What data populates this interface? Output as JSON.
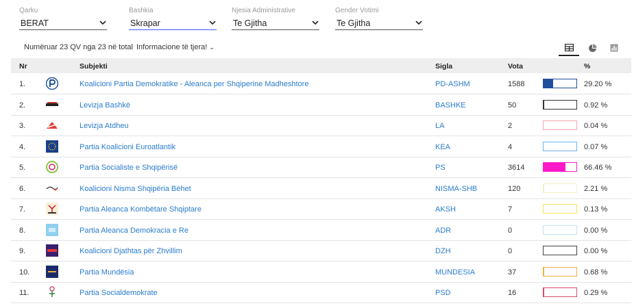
{
  "filters": [
    {
      "label": "Qarku",
      "value": "BERAT",
      "active": false
    },
    {
      "label": "Bashkia",
      "value": "Skrapar",
      "active": true
    },
    {
      "label": "Njesia Administrative",
      "value": "Te Gjitha",
      "active": false
    },
    {
      "label": "Gender Votimi",
      "value": "Te Gjitha",
      "active": false
    }
  ],
  "count_text": "Numëruar 23 QV nga 23 në total",
  "info_text": "Informacione të tjera!",
  "view_icons": [
    "table-icon",
    "pie-chart-icon",
    "bar-chart-icon"
  ],
  "table": {
    "headers": {
      "nr": "Nr",
      "subject": "Subjekti",
      "sigla": "Sigla",
      "votes": "Vota",
      "pct": "%"
    },
    "rows": [
      {
        "nr": "1.",
        "subject": "Koalicioni Partia Demokratike - Aleanca per Shqiperine Madheshtore",
        "sigla": "PD-ASHM",
        "votes": "1588",
        "pct": "29.20 %",
        "share": 0.292,
        "color": "#1f4e9c",
        "logo": "pd-logo-icon"
      },
      {
        "nr": "2.",
        "subject": "Levizja Bashkë",
        "sigla": "BASHKE",
        "votes": "50",
        "pct": "0.92 %",
        "share": 0.0092,
        "color": "#333333",
        "logo": "bashke-logo-icon"
      },
      {
        "nr": "3.",
        "subject": "Levizja Atdheu",
        "sigla": "LA",
        "votes": "2",
        "pct": "0.04 %",
        "share": 0.0004,
        "color": "#f4a7b4",
        "logo": "la-logo-icon"
      },
      {
        "nr": "4.",
        "subject": "Partia Koalicioni Euroatlantik",
        "sigla": "KEA",
        "votes": "4",
        "pct": "0.07 %",
        "share": 0.0007,
        "color": "#6fb1e8",
        "logo": "kea-logo-icon"
      },
      {
        "nr": "5.",
        "subject": "Partia Socialiste e Shqipërisë",
        "sigla": "PS",
        "votes": "3614",
        "pct": "66.46 %",
        "share": 0.6646,
        "color": "#ff19c8",
        "logo": "ps-logo-icon"
      },
      {
        "nr": "6.",
        "subject": "Koalicioni Nisma Shqipëria Bëhet",
        "sigla": "NISMA-SHB",
        "votes": "120",
        "pct": "2.21 %",
        "share": 0.0221,
        "color": "#f3f0c8",
        "logo": "nisma-logo-icon"
      },
      {
        "nr": "7.",
        "subject": "Partia Aleanca Kombëtare Shqiptare",
        "sigla": "AKSH",
        "votes": "7",
        "pct": "0.13 %",
        "share": 0.0013,
        "color": "#f7e25a",
        "logo": "aksh-logo-icon"
      },
      {
        "nr": "8.",
        "subject": "Partia Aleanca Demokracia e Re",
        "sigla": "ADR",
        "votes": "0",
        "pct": "0.00 %",
        "share": 0.0,
        "color": "#bfe3f5",
        "logo": "adr-logo-icon"
      },
      {
        "nr": "9.",
        "subject": "Koalicioni Djathtas për Zhvillim",
        "sigla": "DZH",
        "votes": "0",
        "pct": "0.00 %",
        "share": 0.0,
        "color": "#444444",
        "logo": "dzh-logo-icon"
      },
      {
        "nr": "10.",
        "subject": "Partia Mundësia",
        "sigla": "MUNDESIA",
        "votes": "37",
        "pct": "0.68 %",
        "share": 0.0068,
        "color": "#f0b13c",
        "logo": "mundesia-logo-icon"
      },
      {
        "nr": "11.",
        "subject": "Partia Socialdemokrate",
        "sigla": "PSD",
        "votes": "16",
        "pct": "0.29 %",
        "share": 0.0029,
        "color": "#d64a6a",
        "logo": "psd-logo-icon"
      }
    ]
  }
}
